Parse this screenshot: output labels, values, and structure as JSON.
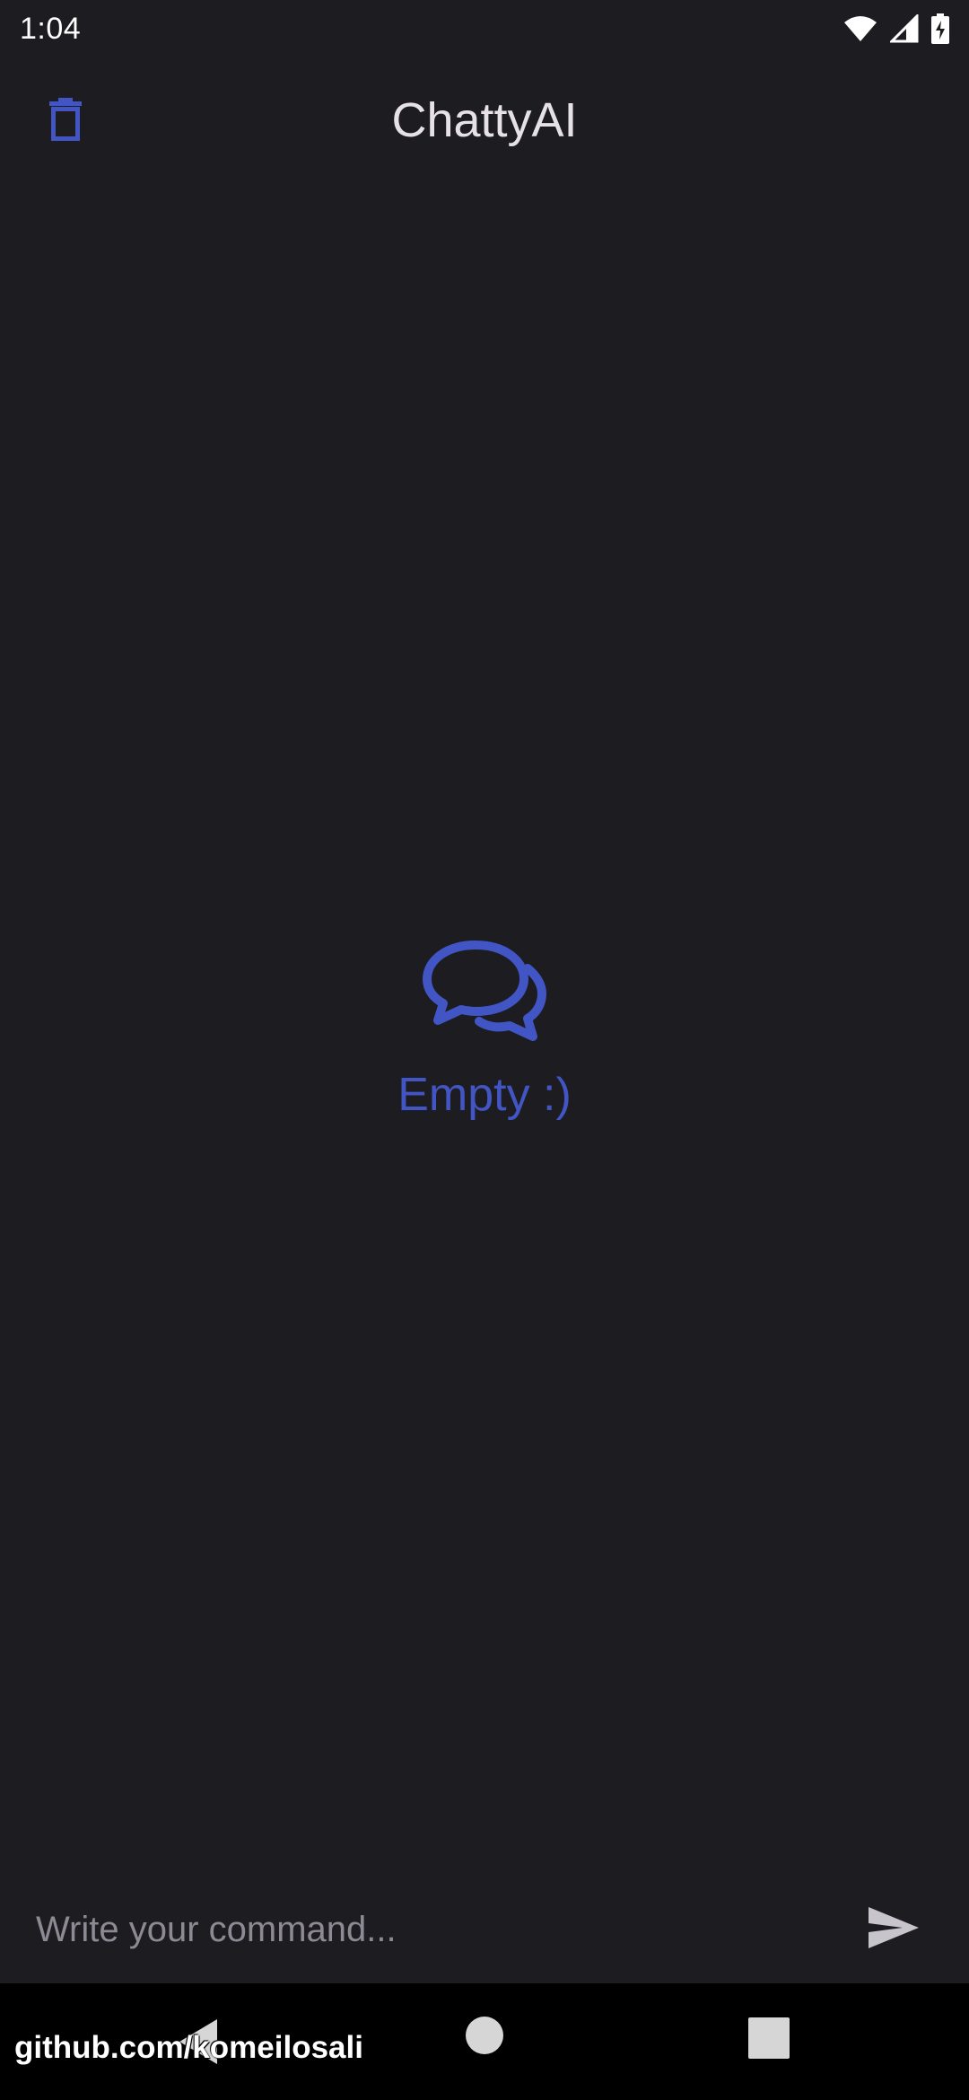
{
  "status_bar": {
    "time": "1:04",
    "icons": [
      "wifi-icon",
      "signal-icon",
      "battery-charging-icon"
    ]
  },
  "app_bar": {
    "title": "ChattyAI",
    "delete_icon": "trash-icon"
  },
  "empty_state": {
    "icon": "chat-bubbles-icon",
    "label": "Empty :)"
  },
  "input_bar": {
    "value": "",
    "placeholder": "Write your command...",
    "send_icon": "send-icon"
  },
  "nav_bar": {
    "buttons": [
      "back-icon",
      "home-icon",
      "recents-icon"
    ]
  },
  "watermark": "github.com/komeilosali",
  "colors": {
    "background": "#1d1c21",
    "accent": "#4255c4",
    "title_text": "#e6e1e5",
    "placeholder_text": "#8e8a94",
    "nav_bar": "#000000"
  }
}
